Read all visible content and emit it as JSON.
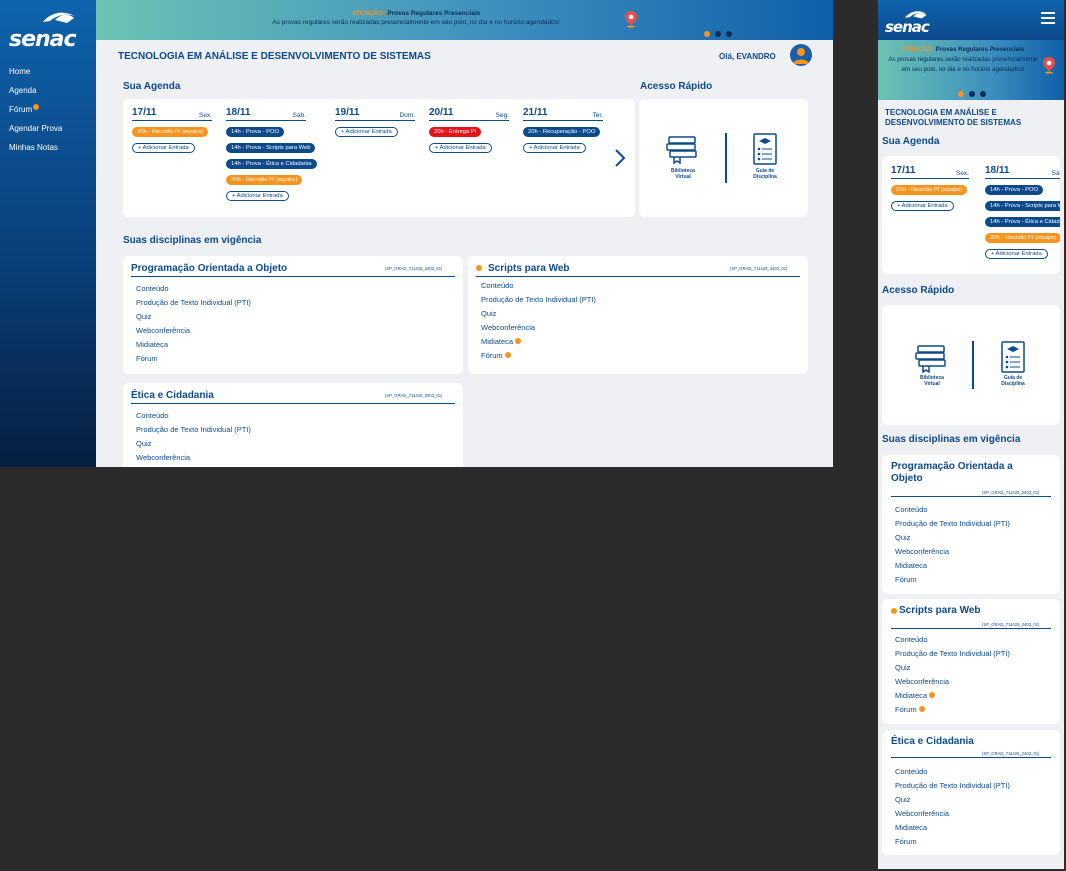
{
  "brand": {
    "logo_text": "senac"
  },
  "sidebar": {
    "items": [
      {
        "label": "Home"
      },
      {
        "label": "Agenda"
      },
      {
        "label": "Fórum"
      },
      {
        "label": "Agendar Prova"
      },
      {
        "label": "Minhas Notas"
      }
    ]
  },
  "banner": {
    "warning": "ATENÇÃO:",
    "headline": "Provas Regulares Presenciais",
    "text": "As provas regulares serão realizadas presencialmente em seu polo, no dia e no horário agendados!",
    "slides": 3,
    "active_slide": 0
  },
  "header": {
    "course": "TECNOLOGIA EM ANÁLISE E DESENVOLVIMENTO DE SISTEMAS",
    "greeting": "Olá, EVANDRO"
  },
  "agenda": {
    "title": "Sua Agenda",
    "days": [
      {
        "date": "17/11",
        "dow": "Sex.",
        "entries": [
          {
            "text": "20h - Reunião PI (equipe)",
            "kind": "orange"
          },
          {
            "text": "+ Adicionar Entrada",
            "kind": "add"
          }
        ]
      },
      {
        "date": "18/11",
        "dow": "Sáb.",
        "entries": [
          {
            "text": "14h - Prova - POO",
            "kind": "blue"
          },
          {
            "text": "14h - Prova - Scripts para Web",
            "kind": "blue"
          },
          {
            "text": "14h - Prova - Ética e Cidadania",
            "kind": "blue"
          },
          {
            "text": "20h - Reunião PI (equipe)",
            "kind": "orange"
          },
          {
            "text": "+ Adicionar Entrada",
            "kind": "add"
          }
        ]
      },
      {
        "date": "19/11",
        "dow": "Dom.",
        "entries": [
          {
            "text": "+ Adicionar Entrada",
            "kind": "add"
          }
        ]
      },
      {
        "date": "20/11",
        "dow": "Seg.",
        "entries": [
          {
            "text": "20h - Entrega PI",
            "kind": "red"
          },
          {
            "text": "+ Adicionar Entrada",
            "kind": "add"
          }
        ]
      },
      {
        "date": "21/11",
        "dow": "Ter.",
        "entries": [
          {
            "text": "20h - Recuperação - POO",
            "kind": "blue"
          },
          {
            "text": "+ Adicionar Entrada",
            "kind": "add"
          }
        ]
      }
    ]
  },
  "quick_access": {
    "title": "Acesso Rápido",
    "items": [
      {
        "label_1": "Biblioteca",
        "label_2": "Virtual",
        "icon": "books-icon"
      },
      {
        "label_1": "Guia de",
        "label_2": "Disciplina",
        "icon": "guide-document-icon"
      }
    ]
  },
  "disciplines": {
    "title": "Suas disciplinas em vigência",
    "items": [
      {
        "title": "Programação Orientada a Objeto",
        "title_m1": "Programação Orientada a",
        "title_m2": "Objeto",
        "code": "(SP_GRAD_711428_2403_01)",
        "notify": false,
        "links": [
          {
            "label": "Conteúdo"
          },
          {
            "label": "Produção de Texto Individual (PTI)"
          },
          {
            "label": "Quiz"
          },
          {
            "label": "Webconferência"
          },
          {
            "label": "Midiateca"
          },
          {
            "label": "Fórum"
          }
        ]
      },
      {
        "title": "Scripts para Web",
        "code": "(SP_GRAD_711429_2403_01)",
        "notify": true,
        "links": [
          {
            "label": "Conteúdo"
          },
          {
            "label": "Produção de Texto Individual (PTI)"
          },
          {
            "label": "Quiz"
          },
          {
            "label": "Webconferência"
          },
          {
            "label": "Midiateca",
            "badge": true
          },
          {
            "label": "Fórum",
            "badge": true
          }
        ]
      },
      {
        "title": "Ética e Cidadania",
        "code": "(SP_GRAD_711426_2403_01)",
        "notify": false,
        "links": [
          {
            "label": "Conteúdo"
          },
          {
            "label": "Produção de Texto Individual (PTI)"
          },
          {
            "label": "Quiz"
          },
          {
            "label": "Webconferência"
          },
          {
            "label": "Midiateca"
          },
          {
            "label": "Fórum"
          }
        ]
      }
    ]
  },
  "colors": {
    "primary": "#0d4a8c",
    "accent": "#f7941d",
    "alert": "#e3141c",
    "background": "#eef0f3"
  }
}
